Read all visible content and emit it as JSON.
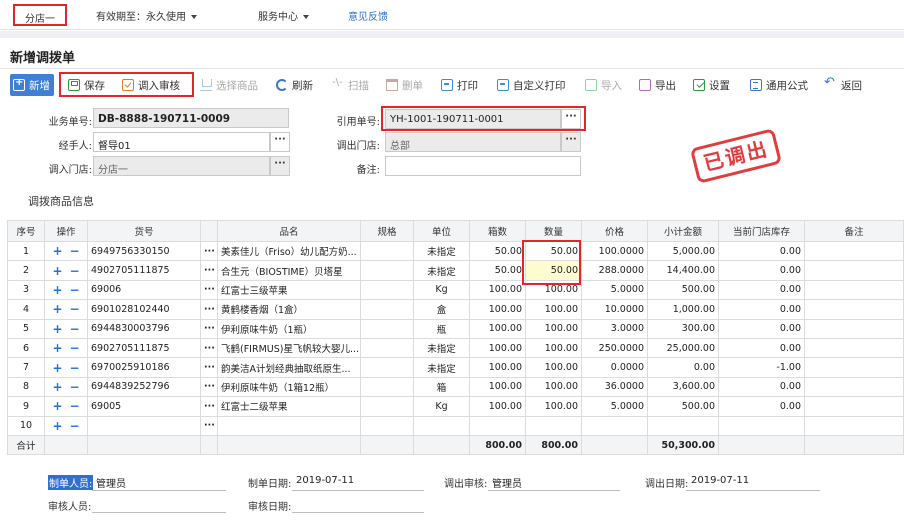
{
  "topbar": {
    "store": "分店一",
    "validity": "有效期至：永久使用",
    "service": "服务中心",
    "feedback": "意见反馈"
  },
  "page_title": "新增调拨单",
  "toolbar": {
    "new": "新增",
    "save": "保存",
    "transfer_in_review": "调入审核",
    "select_goods": "选择商品",
    "refresh": "刷新",
    "scan": "扫描",
    "delete": "删单",
    "print": "打印",
    "custom_print": "自定义打印",
    "import": "导入",
    "export": "导出",
    "settings": "设置",
    "formula": "通用公式",
    "back": "返回"
  },
  "form": {
    "doc_no_label": "业务单号:",
    "doc_no": "DB-8888-190711-0009",
    "ref_no_label": "引用单号:",
    "ref_no": "YH-1001-190711-0001",
    "handler_label": "经手人:",
    "handler": "督导01",
    "out_store_label": "调出门店:",
    "out_store": "总部",
    "in_store_label": "调入门店:",
    "in_store": "分店一",
    "remark_label": "备注:",
    "remark": ""
  },
  "stamp": "已调出",
  "section_title": "调拨商品信息",
  "table": {
    "headers": [
      "序号",
      "操作",
      "货号",
      "",
      "品名",
      "规格",
      "单位",
      "箱数",
      "数量",
      "价格",
      "小计金额",
      "当前门店库存",
      "备注"
    ],
    "rows": [
      {
        "no": "1",
        "sku": "6949756330150",
        "name": "美素佳儿（Friso）幼儿配方奶...",
        "spec": "",
        "unit": "未指定",
        "boxes": "50.00",
        "qty": "50.00",
        "price": "100.0000",
        "amount": "5,000.00",
        "stock": "0.00",
        "remark": ""
      },
      {
        "no": "2",
        "sku": "4902705111875",
        "name": "合生元（BIOSTIME）贝塔星",
        "spec": "",
        "unit": "未指定",
        "boxes": "50.00",
        "qty": "50.00",
        "price": "288.0000",
        "amount": "14,400.00",
        "stock": "0.00",
        "remark": ""
      },
      {
        "no": "3",
        "sku": "69006",
        "name": "红富士三级苹果",
        "spec": "",
        "unit": "Kg",
        "boxes": "100.00",
        "qty": "100.00",
        "price": "5.0000",
        "amount": "500.00",
        "stock": "0.00",
        "remark": ""
      },
      {
        "no": "4",
        "sku": "6901028102440",
        "name": "黄鹤楼香烟（1盒）",
        "spec": "",
        "unit": "盒",
        "boxes": "100.00",
        "qty": "100.00",
        "price": "10.0000",
        "amount": "1,000.00",
        "stock": "0.00",
        "remark": ""
      },
      {
        "no": "5",
        "sku": "6944830003796",
        "name": "伊利原味牛奶（1瓶）",
        "spec": "",
        "unit": "瓶",
        "boxes": "100.00",
        "qty": "100.00",
        "price": "3.0000",
        "amount": "300.00",
        "stock": "0.00",
        "remark": ""
      },
      {
        "no": "6",
        "sku": "6902705111875",
        "name": "飞鹤(FIRMUS)星飞帆较大婴儿...",
        "spec": "",
        "unit": "未指定",
        "boxes": "100.00",
        "qty": "100.00",
        "price": "250.0000",
        "amount": "25,000.00",
        "stock": "0.00",
        "remark": ""
      },
      {
        "no": "7",
        "sku": "6970025910186",
        "name": "韵美洁A计划经典抽取纸原生...",
        "spec": "",
        "unit": "未指定",
        "boxes": "100.00",
        "qty": "100.00",
        "price": "0.0000",
        "amount": "0.00",
        "stock": "-1.00",
        "remark": ""
      },
      {
        "no": "8",
        "sku": "6944839252796",
        "name": "伊利原味牛奶（1箱12瓶）",
        "spec": "",
        "unit": "箱",
        "boxes": "100.00",
        "qty": "100.00",
        "price": "36.0000",
        "amount": "3,600.00",
        "stock": "0.00",
        "remark": ""
      },
      {
        "no": "9",
        "sku": "69005",
        "name": "红富士二级苹果",
        "spec": "",
        "unit": "Kg",
        "boxes": "100.00",
        "qty": "100.00",
        "price": "5.0000",
        "amount": "500.00",
        "stock": "0.00",
        "remark": ""
      },
      {
        "no": "10",
        "sku": "",
        "name": "",
        "spec": "",
        "unit": "",
        "boxes": "",
        "qty": "",
        "price": "",
        "amount": "",
        "stock": "",
        "remark": ""
      }
    ],
    "footer": {
      "label": "合计",
      "boxes": "800.00",
      "qty": "800.00",
      "amount": "50,300.00"
    }
  },
  "bottom": {
    "maker_label": "制单人员:",
    "maker": "管理员",
    "make_date_label": "制单日期:",
    "make_date": "2019-07-11",
    "out_review_label": "调出审核:",
    "out_review": "管理员",
    "out_date_label": "调出日期:",
    "out_date": "2019-07-11",
    "reviewer_label": "审核人员:",
    "reviewer": "",
    "review_date_label": "审核日期:",
    "review_date": ""
  },
  "colors": {
    "accent": "#3f7fd6",
    "highlight_border": "#e0282c",
    "stamp": "#e0282c",
    "edit_cell": "#fffbd0"
  }
}
